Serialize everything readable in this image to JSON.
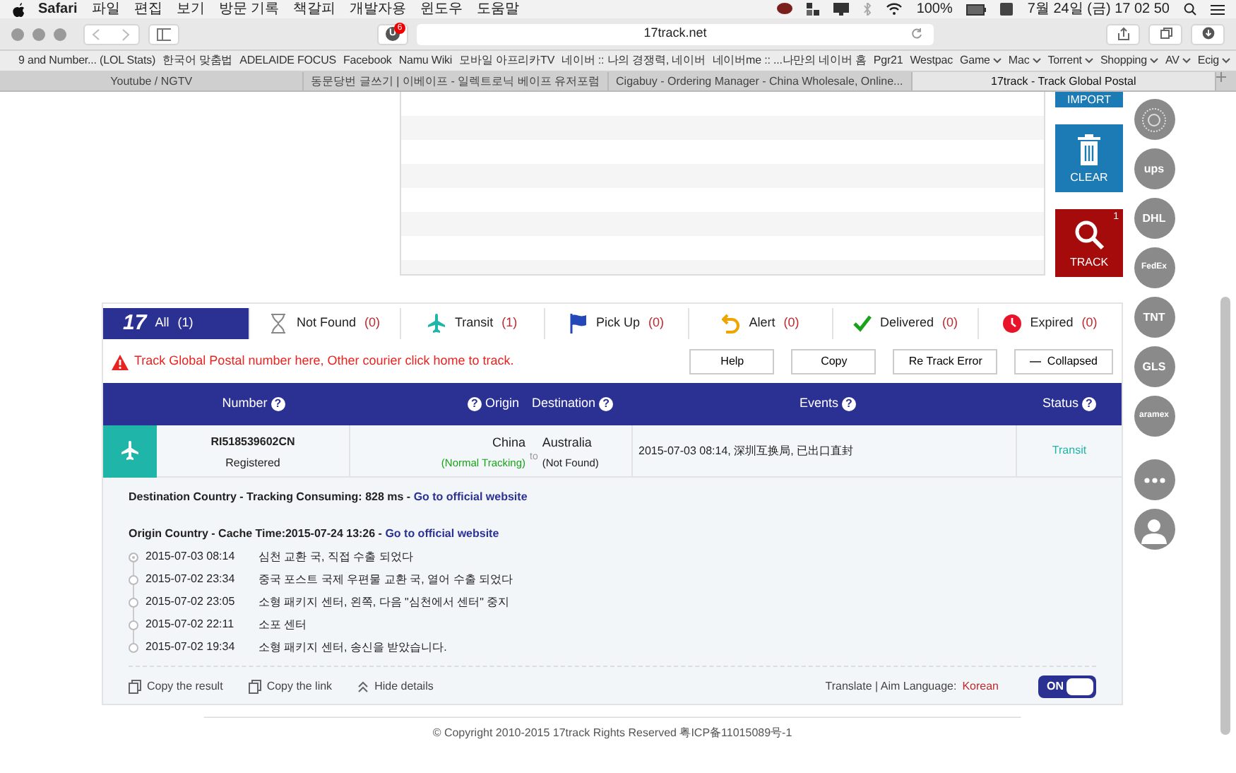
{
  "menubar": {
    "app": "Safari",
    "menus": [
      "파일",
      "편집",
      "보기",
      "방문 기록",
      "책갈피",
      "개발자용",
      "윈도우",
      "도움말"
    ],
    "battery": "100%",
    "clock": "7월 24일 (금) 17 02 50"
  },
  "toolbar": {
    "extension_label": "U",
    "extension_badge": "6",
    "url": "17track.net"
  },
  "bookmarks": [
    {
      "label": "9 and Number... (LOL Stats)",
      "dropdown": false
    },
    {
      "label": "한국어 맞춤법",
      "dropdown": false
    },
    {
      "label": "ADELAIDE FOCUS",
      "dropdown": false
    },
    {
      "label": "Facebook",
      "dropdown": false
    },
    {
      "label": "Namu Wiki",
      "dropdown": false
    },
    {
      "label": "모바일 아프리카TV",
      "dropdown": false
    },
    {
      "label": "네이버 :: 나의 경쟁력, 네이버",
      "dropdown": false
    },
    {
      "label": "네이버me :: ...나만의 네이버 홈",
      "dropdown": false
    },
    {
      "label": "Pgr21",
      "dropdown": false
    },
    {
      "label": "Westpac",
      "dropdown": false
    },
    {
      "label": "Game",
      "dropdown": true
    },
    {
      "label": "Mac",
      "dropdown": true
    },
    {
      "label": "Torrent",
      "dropdown": true
    },
    {
      "label": "Shopping",
      "dropdown": true
    },
    {
      "label": "AV",
      "dropdown": true
    },
    {
      "label": "Ecig",
      "dropdown": true
    }
  ],
  "tabs": [
    {
      "title": "Youtube / NGTV",
      "selected": false
    },
    {
      "title": "동문당번 글쓰기 | 이베이프 - 일렉트로닉 베이프 유저포럼",
      "selected": false
    },
    {
      "title": "Cigabuy - Ordering Manager - China Wholesale, Online...",
      "selected": false
    },
    {
      "title": "17track - Track Global Postal",
      "selected": true
    }
  ],
  "side_buttons": [
    {
      "kind": "import",
      "label": "IMPORT"
    },
    {
      "kind": "clear",
      "label": "CLEAR"
    },
    {
      "kind": "track",
      "label": "TRACK",
      "badge": "1"
    }
  ],
  "carriers": [
    {
      "kind": "seal"
    },
    {
      "kind": "logo",
      "label": "ups"
    },
    {
      "kind": "logo",
      "label": "DHL"
    },
    {
      "kind": "logo",
      "label": "FedEx"
    },
    {
      "kind": "logo",
      "label": "TNT"
    },
    {
      "kind": "logo",
      "label": "GLS"
    },
    {
      "kind": "logo",
      "label": "aramex"
    },
    {
      "kind": "more"
    },
    {
      "kind": "user"
    }
  ],
  "logo": "17",
  "status_tabs": [
    {
      "kind": "all",
      "label": "All",
      "count": "(1)",
      "selected": true
    },
    {
      "kind": "not_found",
      "label": "Not Found",
      "count": "(0)",
      "selected": false
    },
    {
      "kind": "transit",
      "label": "Transit",
      "count": "(1)",
      "selected": false
    },
    {
      "kind": "pickup",
      "label": "Pick Up",
      "count": "(0)",
      "selected": false
    },
    {
      "kind": "alert",
      "label": "Alert",
      "count": "(0)",
      "selected": false
    },
    {
      "kind": "delivered",
      "label": "Delivered",
      "count": "(0)",
      "selected": false
    },
    {
      "kind": "expired",
      "label": "Expired",
      "count": "(0)",
      "selected": false
    }
  ],
  "notice": "Track Global Postal number here, Other courier click home to track.",
  "actions": [
    {
      "kind": "plain",
      "label": "Help"
    },
    {
      "kind": "plain",
      "label": "Copy"
    },
    {
      "kind": "plain",
      "label": "Re Track Error"
    },
    {
      "kind": "collapse",
      "label": "Collapsed"
    }
  ],
  "table": {
    "columns": [
      {
        "label": "Number",
        "help": "?",
        "help_before": false
      },
      {
        "label": "Origin",
        "help": "?",
        "help_before": true
      },
      {
        "label": "Destination",
        "help": "?",
        "help_before": false
      },
      {
        "label": "Events",
        "help": "?",
        "help_before": false
      },
      {
        "label": "Status",
        "help": "?",
        "help_before": false
      }
    ],
    "rows": [
      {
        "number": "RI518539602CN",
        "number_status": "Registered",
        "origin": "China",
        "origin_note": "(Normal Tracking)",
        "to": "to",
        "destination": "Australia",
        "destination_note": "(Not Found)",
        "event": "2015-07-03 08:14, 深圳互换局, 已出口直封",
        "status": "Transit"
      }
    ]
  },
  "details": {
    "destination_line": {
      "text": "Destination Country - Tracking Consuming: 828 ms - ",
      "link": "Go to official website"
    },
    "origin_line": {
      "text": "Origin Country - Cache Time:2015-07-24 13:26 - ",
      "link": "Go to official website"
    },
    "events": [
      {
        "time": "2015-07-03 08:14",
        "text": "심천 교환 국, 직접 수출 되었다",
        "current": true
      },
      {
        "time": "2015-07-02 23:34",
        "text": "중국 포스트 국제 우편물 교환 국, 열어 수출 되었다",
        "current": false
      },
      {
        "time": "2015-07-02 23:05",
        "text": "소형 패키지 센터, 왼쪽, 다음 \"심천에서 센터\" 중지",
        "current": false
      },
      {
        "time": "2015-07-02 22:11",
        "text": "소포 센터",
        "current": false
      },
      {
        "time": "2015-07-02 19:34",
        "text": "소형 패키지 센터, 송신을 받았습니다.",
        "current": false
      }
    ],
    "footer_actions": [
      {
        "kind": "copy",
        "label": "Copy the result"
      },
      {
        "kind": "copy",
        "label": "Copy the link"
      },
      {
        "kind": "hide",
        "label": "Hide details"
      }
    ],
    "translate": "Translate | Aim Language:",
    "language": "Korean",
    "toggle": {
      "label": "ON",
      "on": true
    }
  },
  "copyright": "© Copyright 2010-2015 17track Rights Reserved 粤ICP备11015089号-1"
}
